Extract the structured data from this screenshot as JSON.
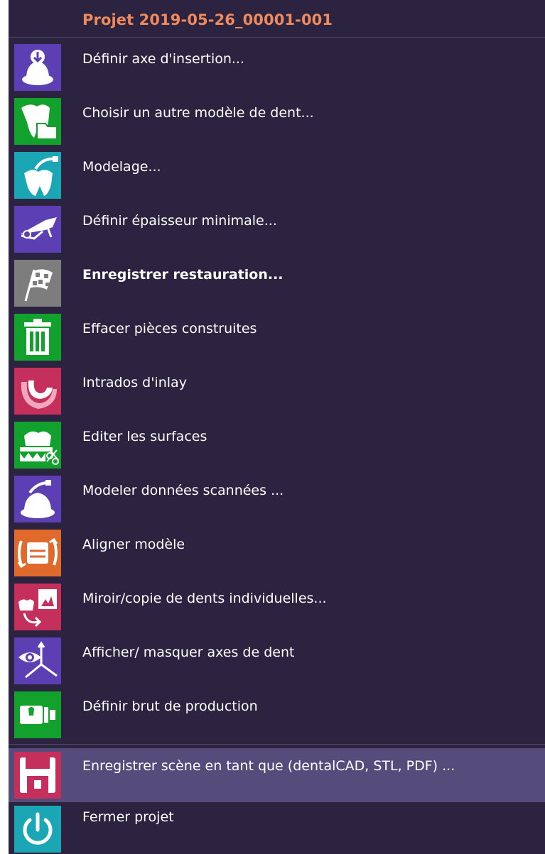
{
  "menu": {
    "title": "Projet 2019-05-26_00001-001",
    "title_color": "#ef8a5c",
    "items": [
      {
        "label": "Définir axe d'insertion...",
        "icon": "insertion-axis-icon",
        "color": "#5c3fb3",
        "bold": false
      },
      {
        "label": "Choisir un autre modèle de dent...",
        "icon": "tooth-folder-icon",
        "color": "#12a12c",
        "bold": false
      },
      {
        "label": "Modelage...",
        "icon": "tooth-modeling-icon",
        "color": "#1aa6b5",
        "bold": false
      },
      {
        "label": "Définir épaisseur minimale...",
        "icon": "thickness-caliper-icon",
        "color": "#5c3fb3",
        "bold": false
      },
      {
        "label": "Enregistrer restauration...",
        "icon": "checkered-flag-icon",
        "color": "#7d7d7d",
        "bold": true
      },
      {
        "label": "Effacer pièces construites",
        "icon": "trash-icon",
        "color": "#12a12c",
        "bold": false
      },
      {
        "label": "Intrados d'inlay",
        "icon": "inlay-intrados-icon",
        "color": "#c42f5c",
        "bold": false
      },
      {
        "label": "Editer les surfaces",
        "icon": "surface-scissors-icon",
        "color": "#12a12c",
        "bold": false
      },
      {
        "label": "Modeler données scannées ...",
        "icon": "scan-modeling-icon",
        "color": "#5c3fb3",
        "bold": false
      },
      {
        "label": "Aligner modèle",
        "icon": "align-model-icon",
        "color": "#e06a2c",
        "bold": false
      },
      {
        "label": "Miroir/copie de dents individuelles...",
        "icon": "mirror-copy-icon",
        "color": "#c42f5c",
        "bold": false
      },
      {
        "label": "Afficher/ masquer axes de dent",
        "icon": "eye-axes-icon",
        "color": "#5c3fb3",
        "bold": false
      },
      {
        "label": "Définir brut de production",
        "icon": "production-blank-icon",
        "color": "#12a12c",
        "bold": false
      }
    ],
    "footer_items": [
      {
        "label": "Enregistrer scène en tant que (dentalCAD, STL, PDF) ...",
        "icon": "save-floppy-icon",
        "color": "#c42f5c",
        "highlighted": true
      },
      {
        "label": "Fermer projet",
        "icon": "power-icon",
        "color": "#1aa6b5",
        "highlighted": false
      }
    ]
  }
}
